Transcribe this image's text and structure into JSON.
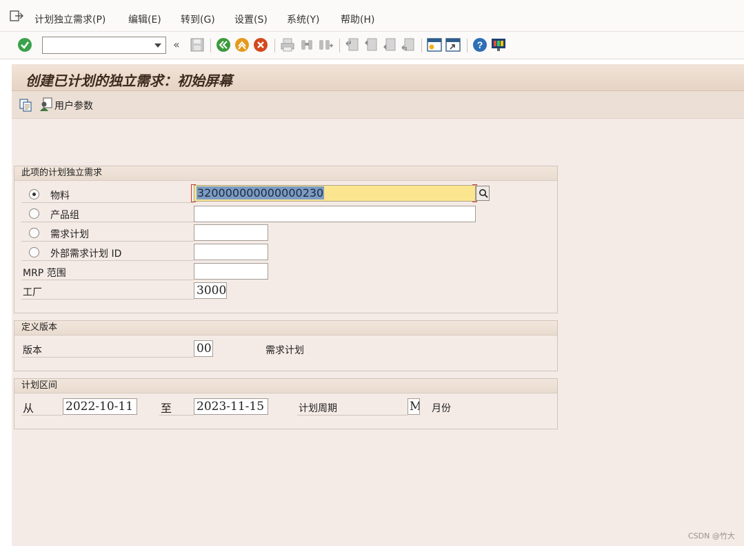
{
  "menu": {
    "items": [
      "计划独立需求(P)",
      "编辑(E)",
      "转到(G)",
      "设置(S)",
      "系统(Y)",
      "帮助(H)"
    ]
  },
  "toolbar": {
    "command_field": "",
    "back_glyph": "«",
    "icons": [
      "enter-icon",
      "save-icon",
      "back-icon",
      "exit-icon",
      "cancel-icon",
      "print-icon",
      "find-icon",
      "find-next-icon",
      "first-page-icon",
      "previous-page-icon",
      "next-page-icon",
      "last-page-icon",
      "new-session-icon",
      "shortcut-icon",
      "help-icon",
      "layout-icon"
    ]
  },
  "title": "创建已计划的独立需求：初始屏幕",
  "app_toolbar": {
    "user_params_label": "用户参数"
  },
  "groups": {
    "item": {
      "title": "此项的计划独立需求",
      "rows": {
        "material": "物料",
        "product_group": "产品组",
        "req_plan": "需求计划",
        "ext_plan_id": "外部需求计划 ID",
        "mrp_area": "MRP 范围",
        "plant": "工厂"
      },
      "values": {
        "material": "320000000000000230",
        "product_group": "",
        "req_plan": "",
        "ext_plan_id": "",
        "mrp_area": "",
        "plant": "3000"
      },
      "selected_radio": "material"
    },
    "version": {
      "title": "定义版本",
      "label": "版本",
      "value": "00",
      "description": "需求计划"
    },
    "period": {
      "title": "计划区间",
      "from_label": "从",
      "from_value": "2022-10-11",
      "to_label": "至",
      "to_value": "2023-11-15",
      "period_label": "计划周期",
      "period_value": "M",
      "period_desc": "月份"
    }
  },
  "watermark": "CSDN @竹大",
  "colors": {
    "active_field": "#fbe68f",
    "selection": "#7c9cc4",
    "panel": "#f5ebe6",
    "title_bar": "#e6d3c3"
  }
}
